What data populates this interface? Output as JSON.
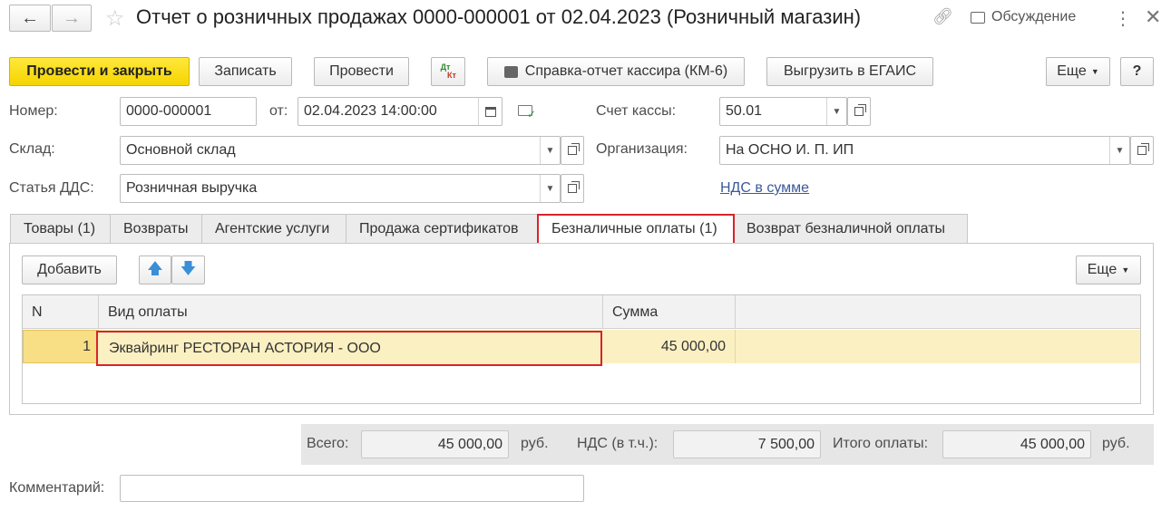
{
  "header": {
    "title": "Отчет о розничных продажах 0000-000001 от 02.04.2023 (Розничный магазин)",
    "discussion_label": "Обсуждение"
  },
  "toolbar": {
    "post_close": "Провести и закрыть",
    "save": "Записать",
    "post": "Провести",
    "dtkt_top": "Дт",
    "dtkt_bottom": "Кт",
    "cashier_report": "Справка-отчет кассира (КМ-6)",
    "egais": "Выгрузить в ЕГАИС",
    "more": "Еще",
    "help": "?"
  },
  "form": {
    "number_label": "Номер:",
    "number_value": "0000-000001",
    "date_label": "от:",
    "date_value": "02.04.2023 14:00:00",
    "cash_account_label": "Счет кассы:",
    "cash_account_value": "50.01",
    "warehouse_label": "Склад:",
    "warehouse_value": "Основной склад",
    "organization_label": "Организация:",
    "organization_value": "На ОСНО И. П. ИП",
    "dds_label": "Статья ДДС:",
    "dds_value": "Розничная выручка",
    "vat_link": "НДС в сумме"
  },
  "tabs": [
    {
      "label": "Товары (1)"
    },
    {
      "label": "Возвраты"
    },
    {
      "label": "Агентские услуги"
    },
    {
      "label": "Продажа сертификатов"
    },
    {
      "label": "Безналичные оплаты (1)"
    },
    {
      "label": "Возврат безналичной оплаты"
    }
  ],
  "table_toolbar": {
    "add": "Добавить",
    "more": "Еще"
  },
  "table": {
    "columns": [
      "N",
      "Вид оплаты",
      "Сумма"
    ],
    "rows": [
      {
        "n": "1",
        "payment_type": "Эквайринг РЕСТОРАН АСТОРИЯ - ООО",
        "amount": "45 000,00"
      }
    ]
  },
  "totals": {
    "total_label": "Всего:",
    "total_value": "45 000,00",
    "total_unit": "руб.",
    "vat_label": "НДС (в т.ч.):",
    "vat_value": "7 500,00",
    "payment_label": "Итого оплаты:",
    "payment_value": "45 000,00",
    "payment_unit": "руб."
  },
  "comment": {
    "label": "Комментарий:",
    "value": ""
  },
  "colors": {
    "primary_yellow": "#f5d400",
    "highlight_red": "#d8232a",
    "selected_row": "#fbf0c2",
    "link_blue": "#3b5a9a"
  }
}
